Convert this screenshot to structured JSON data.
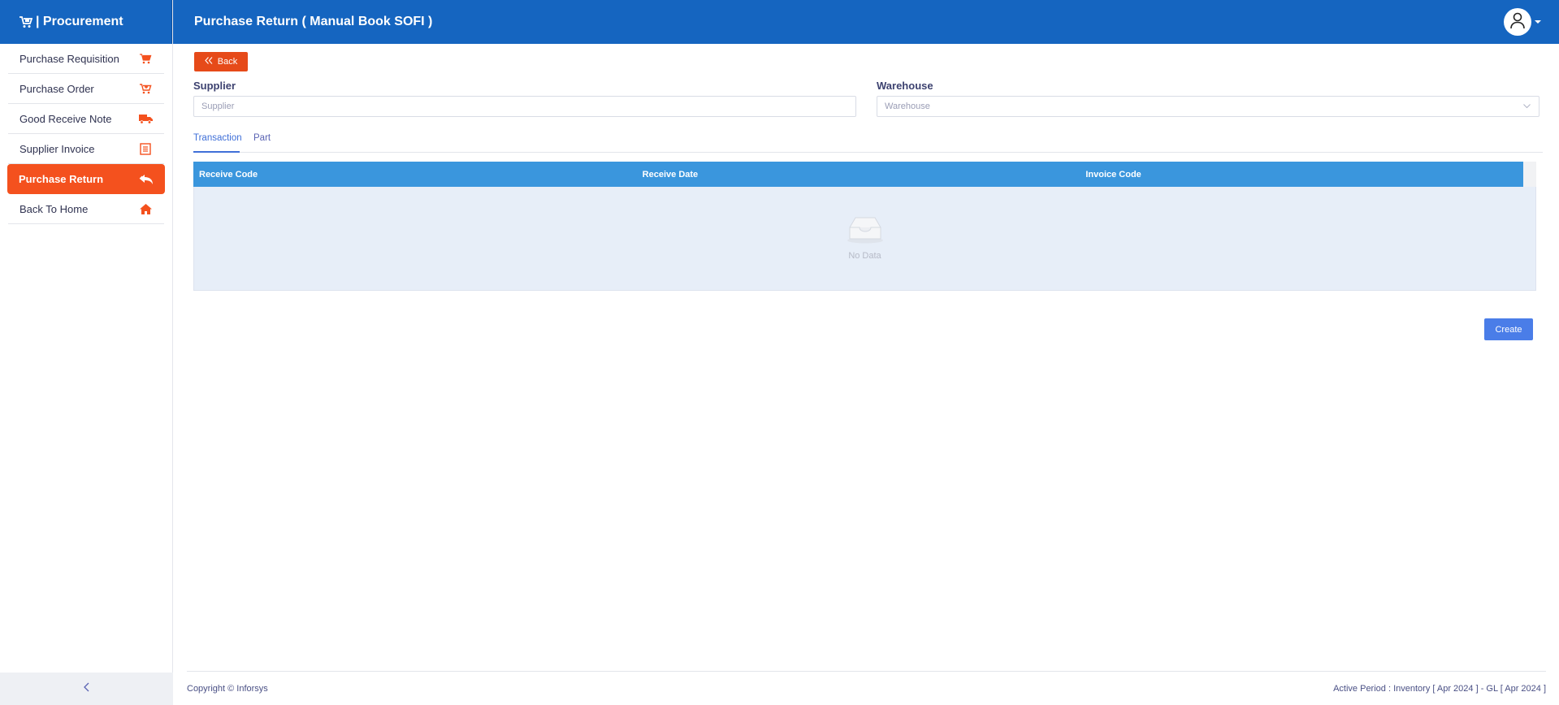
{
  "sidebar": {
    "brand": "| Procurement",
    "items": [
      {
        "label": "Purchase Requisition",
        "icon": "cart-icon"
      },
      {
        "label": "Purchase Order",
        "icon": "cart-plus-icon"
      },
      {
        "label": "Good Receive Note",
        "icon": "truck-icon"
      },
      {
        "label": "Supplier Invoice",
        "icon": "invoice-icon"
      },
      {
        "label": "Purchase Return",
        "icon": "reply-icon",
        "active": true
      },
      {
        "label": "Back To Home",
        "icon": "home-icon"
      }
    ],
    "collapse_icon": "chevron-left-icon"
  },
  "header": {
    "title": "Purchase Return ( Manual Book SOFI )",
    "user_icon": "user-icon"
  },
  "main": {
    "back_label": "Back",
    "supplier_label": "Supplier",
    "supplier_placeholder": "Supplier",
    "warehouse_label": "Warehouse",
    "warehouse_placeholder": "Warehouse",
    "tabs": [
      {
        "label": "Transaction",
        "active": true
      },
      {
        "label": "Part",
        "active": false
      }
    ],
    "table": {
      "columns": [
        "Receive Code",
        "Receive Date",
        "Invoice Code"
      ],
      "rows": [],
      "empty_text": "No Data"
    },
    "create_label": "Create"
  },
  "footer": {
    "copyright": "Copyright © Inforsys",
    "period": "Active Period  :  Inventory [ Apr 2024 ]  -  GL [ Apr 2024 ]"
  },
  "colors": {
    "header_blue": "#1565c0",
    "accent_orange": "#f4511e",
    "table_header": "#3a96dd",
    "create_button": "#4a7de8"
  }
}
